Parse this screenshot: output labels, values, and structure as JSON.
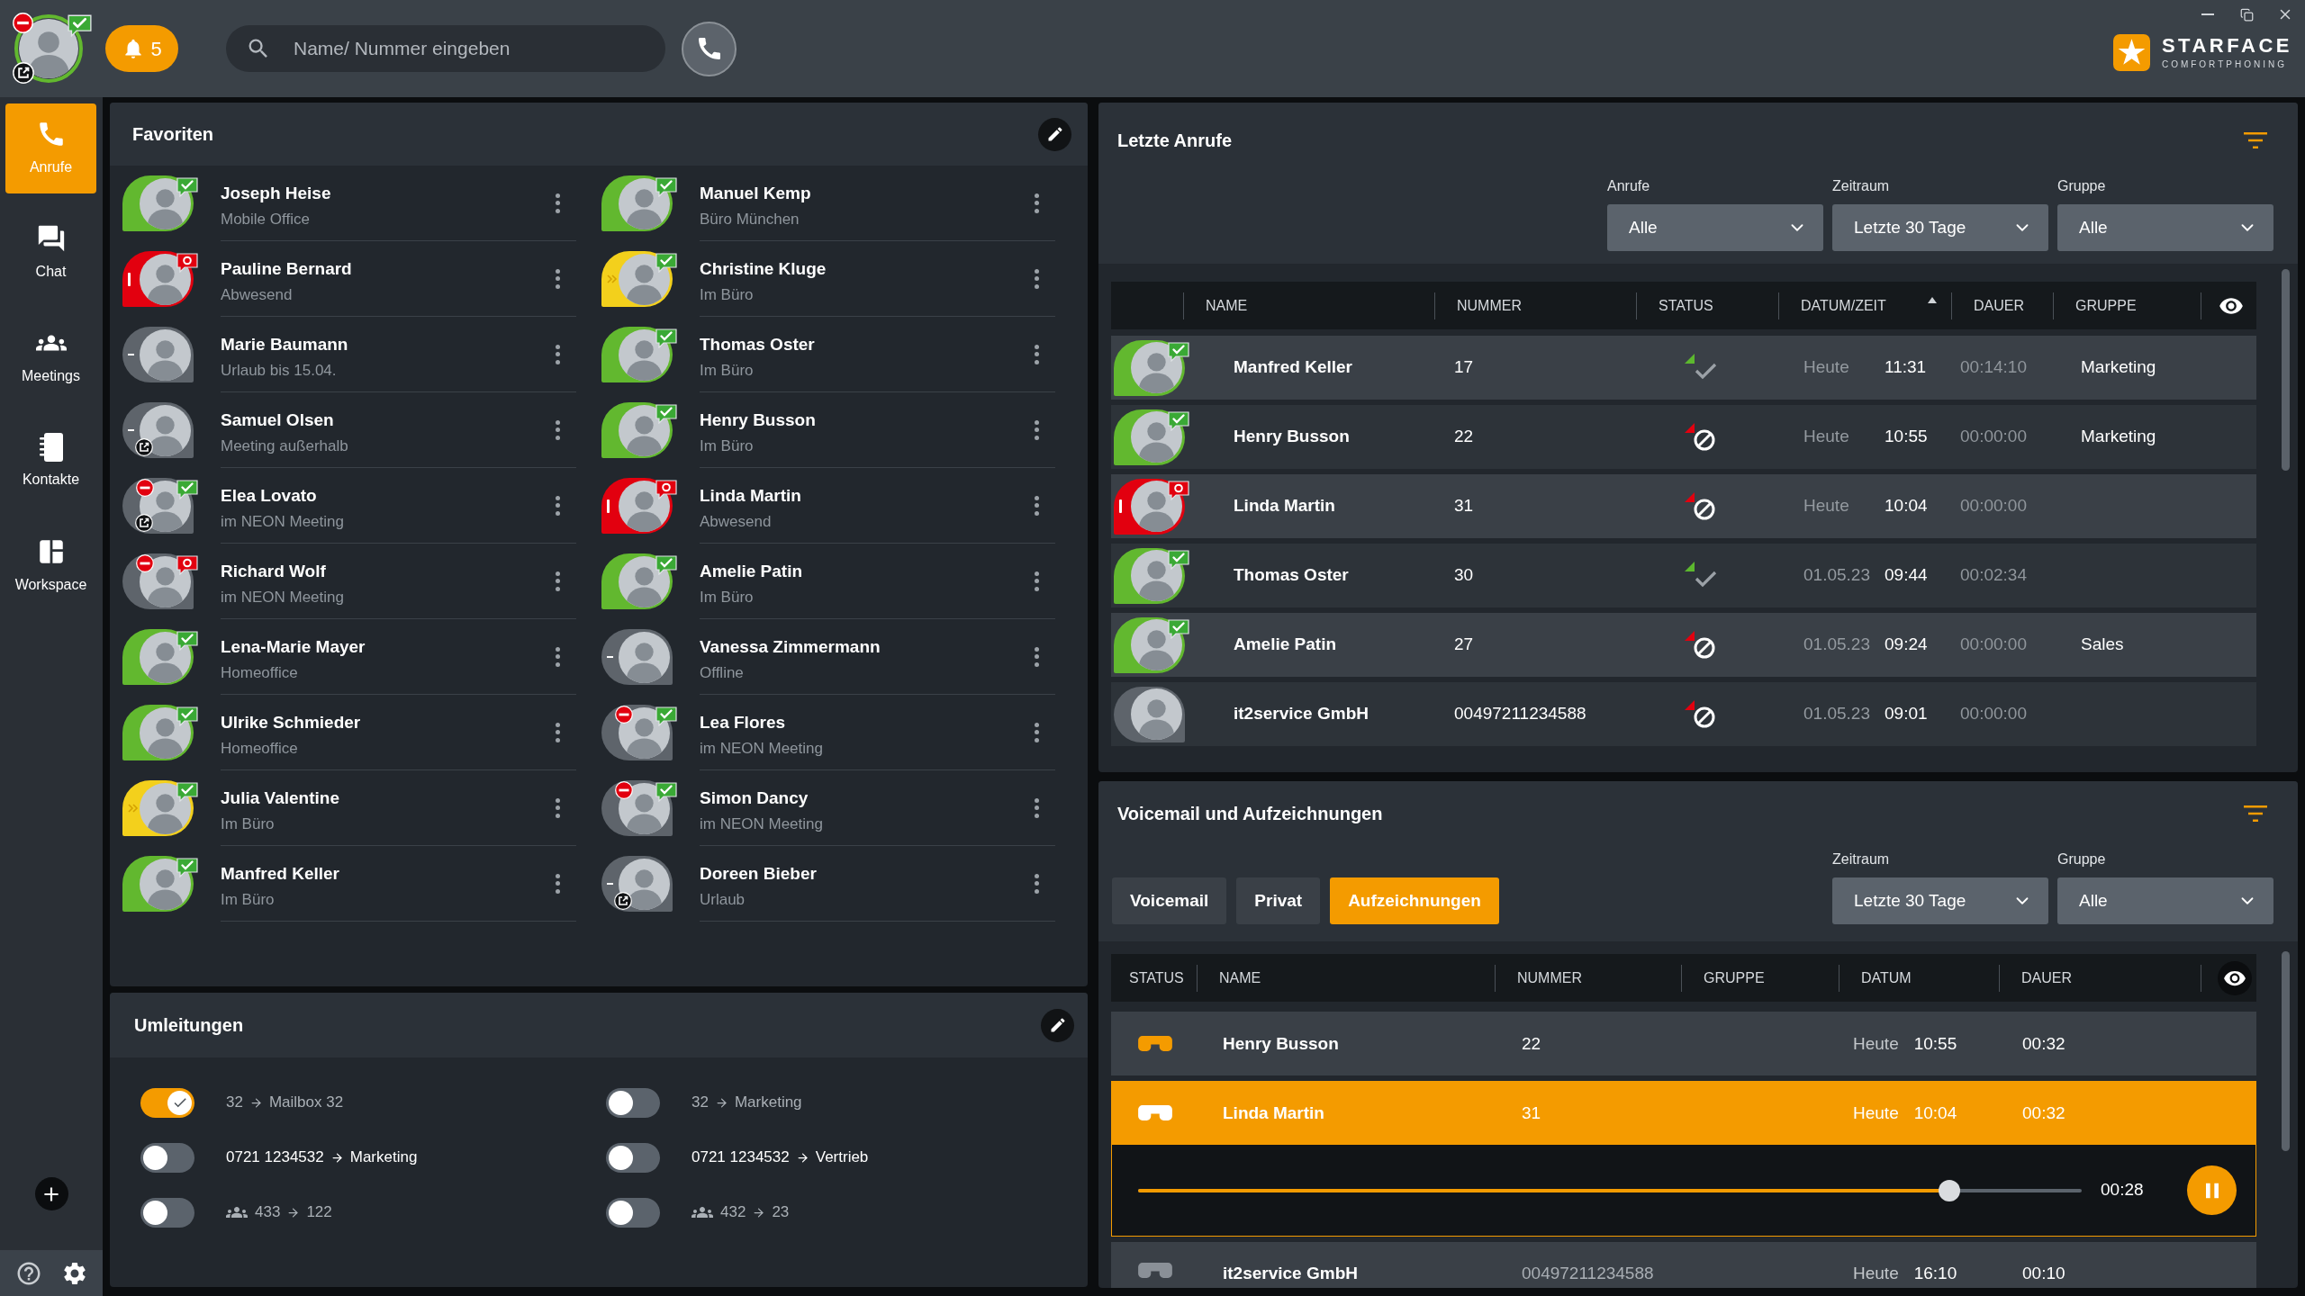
{
  "header": {
    "user": {
      "kind": "online",
      "chat_available": true,
      "chat_busy": false,
      "dnd": true,
      "redirect": true
    },
    "notifications": {
      "count": "5"
    },
    "search": {
      "placeholder": "Name/ Nummer eingeben"
    }
  },
  "logo": {
    "name": "STARFACE",
    "tagline": "COMFORTPHONING"
  },
  "sidebar": {
    "items": [
      {
        "label": "Anrufe",
        "selected": true
      },
      {
        "label": "Chat",
        "selected": false
      },
      {
        "label": "Meetings",
        "selected": false
      },
      {
        "label": "Kontakte",
        "selected": false
      },
      {
        "label": "Workspace",
        "selected": false
      }
    ]
  },
  "favorites": {
    "title": "Favoriten",
    "columns": [
      {
        "contacts": [
          {
            "name": "Joseph Heise",
            "status": "Mobile Office",
            "kind": "online",
            "chat_available": true,
            "chat_busy": false,
            "dnd": false,
            "redirect": false
          },
          {
            "name": "Pauline Bernard",
            "status": "Abwesend",
            "kind": "absent",
            "chat_available": false,
            "chat_busy": true,
            "dnd": false,
            "redirect": false
          },
          {
            "name": "Marie Baumann",
            "status": "Urlaub bis 15.04.",
            "kind": "offline",
            "chat_available": false,
            "chat_busy": false,
            "dnd": false,
            "redirect": false
          },
          {
            "name": "Samuel Olsen",
            "status": "Meeting außerhalb",
            "kind": "offline",
            "chat_available": false,
            "chat_busy": false,
            "dnd": false,
            "redirect": true
          },
          {
            "name": "Elea Lovato",
            "status": "im NEON Meeting",
            "kind": "unknown",
            "chat_available": true,
            "chat_busy": false,
            "dnd": true,
            "redirect": true
          },
          {
            "name": "Richard Wolf",
            "status": "im NEON Meeting",
            "kind": "unknown",
            "chat_available": false,
            "chat_busy": true,
            "dnd": true,
            "redirect": false
          },
          {
            "name": "Lena-Marie Mayer",
            "status": "Homeoffice",
            "kind": "online",
            "chat_available": true,
            "chat_busy": false,
            "dnd": false,
            "redirect": false
          },
          {
            "name": "Ulrike Schmieder",
            "status": "Homeoffice",
            "kind": "online",
            "chat_available": true,
            "chat_busy": false,
            "dnd": false,
            "redirect": false
          },
          {
            "name": "Julia Valentine",
            "status": "Im Büro",
            "kind": "forwarded",
            "chat_available": true,
            "chat_busy": false,
            "dnd": false,
            "redirect": false
          },
          {
            "name": "Manfred Keller",
            "status": "Im Büro",
            "kind": "online",
            "chat_available": true,
            "chat_busy": false,
            "dnd": false,
            "redirect": false
          }
        ]
      },
      {
        "contacts": [
          {
            "name": "Manuel Kemp",
            "status": "Büro München",
            "kind": "online",
            "chat_available": true,
            "chat_busy": false,
            "dnd": false,
            "redirect": false
          },
          {
            "name": "Christine Kluge",
            "status": "Im Büro",
            "kind": "forwarded",
            "chat_available": true,
            "chat_busy": false,
            "dnd": false,
            "redirect": false
          },
          {
            "name": "Thomas Oster",
            "status": "Im Büro",
            "kind": "online",
            "chat_available": true,
            "chat_busy": false,
            "dnd": false,
            "redirect": false
          },
          {
            "name": "Henry Busson",
            "status": "Im Büro",
            "kind": "online",
            "chat_available": true,
            "chat_busy": false,
            "dnd": false,
            "redirect": false
          },
          {
            "name": "Linda Martin",
            "status": "Abwesend",
            "kind": "absent",
            "chat_available": false,
            "chat_busy": true,
            "dnd": false,
            "redirect": false
          },
          {
            "name": "Amelie Patin",
            "status": "Im Büro",
            "kind": "online",
            "chat_available": true,
            "chat_busy": false,
            "dnd": false,
            "redirect": false
          },
          {
            "name": "Vanessa Zimmermann",
            "status": "Offline",
            "kind": "offline",
            "chat_available": false,
            "chat_busy": false,
            "dnd": false,
            "redirect": false
          },
          {
            "name": "Lea Flores",
            "status": "im NEON Meeting",
            "kind": "unknown",
            "chat_available": true,
            "chat_busy": false,
            "dnd": true,
            "redirect": false
          },
          {
            "name": "Simon Dancy",
            "status": "im NEON Meeting",
            "kind": "unknown",
            "chat_available": true,
            "chat_busy": false,
            "dnd": true,
            "redirect": false
          },
          {
            "name": "Doreen Bieber",
            "status": "Urlaub",
            "kind": "offline",
            "chat_available": false,
            "chat_busy": false,
            "dnd": false,
            "redirect": true
          }
        ]
      }
    ]
  },
  "forwarding": {
    "title": "Umleitungen",
    "rules": [
      {
        "kind": "internal",
        "on": true,
        "from": "32",
        "to": "Mailbox 32"
      },
      {
        "kind": "internal",
        "on": false,
        "from": "32",
        "to": "Marketing"
      },
      {
        "kind": "external",
        "on": false,
        "from": "0721 1234532",
        "to": "Marketing"
      },
      {
        "kind": "external",
        "on": false,
        "from": "0721 1234532",
        "to": "Vertrieb"
      },
      {
        "kind": "group",
        "on": false,
        "from": "433",
        "to": "122"
      },
      {
        "kind": "group",
        "on": false,
        "from": "432",
        "to": "23"
      }
    ]
  },
  "recent_calls": {
    "title": "Letzte Anrufe",
    "filters": [
      {
        "label": "Anrufe",
        "value": "Alle"
      },
      {
        "label": "Zeitraum",
        "value": "Letzte 30 Tage"
      },
      {
        "label": "Gruppe",
        "value": "Alle"
      }
    ],
    "columns": [
      {
        "label": "NAME",
        "sorted": false
      },
      {
        "label": "NUMMER",
        "sorted": false
      },
      {
        "label": "STATUS",
        "sorted": false
      },
      {
        "label": "DATUM/ZEIT",
        "sorted": true
      },
      {
        "label": "DAUER",
        "sorted": false
      },
      {
        "label": "GRUPPE",
        "sorted": false
      }
    ],
    "rows": [
      {
        "avatar": {
          "kind": "online",
          "chat_available": true,
          "chat_busy": false,
          "dnd": false,
          "redirect": false
        },
        "name": "Manfred Keller",
        "number": "17",
        "missed": false,
        "date": "Heute",
        "time": "11:31",
        "duration": "00:14:10",
        "group": "Marketing"
      },
      {
        "avatar": {
          "kind": "online",
          "chat_available": true,
          "chat_busy": false,
          "dnd": false,
          "redirect": false
        },
        "name": "Henry Busson",
        "number": "22",
        "missed": true,
        "date": "Heute",
        "time": "10:55",
        "duration": "00:00:00",
        "group": "Marketing"
      },
      {
        "avatar": {
          "kind": "absent",
          "chat_available": false,
          "chat_busy": true,
          "dnd": false,
          "redirect": false
        },
        "name": "Linda Martin",
        "number": "31",
        "missed": true,
        "date": "Heute",
        "time": "10:04",
        "duration": "00:00:00"
      },
      {
        "avatar": {
          "kind": "online",
          "chat_available": true,
          "chat_busy": false,
          "dnd": false,
          "redirect": false
        },
        "name": "Thomas Oster",
        "number": "30",
        "missed": false,
        "date": "01.05.23",
        "time": "09:44",
        "duration": "00:02:34"
      },
      {
        "avatar": {
          "kind": "online",
          "chat_available": true,
          "chat_busy": false,
          "dnd": false,
          "redirect": false
        },
        "name": "Amelie Patin",
        "number": "27",
        "missed": true,
        "date": "01.05.23",
        "time": "09:24",
        "duration": "00:00:00",
        "group": "Sales"
      },
      {
        "avatar": {
          "kind": "unknown",
          "chat_available": false,
          "chat_busy": false,
          "dnd": false,
          "redirect": false
        },
        "name": "it2service GmbH",
        "number": "00497211234588",
        "missed": true,
        "date": "01.05.23",
        "time": "09:01",
        "duration": "00:00:00"
      }
    ]
  },
  "voicemail": {
    "title": "Voicemail und Aufzeichnungen",
    "tabs": [
      {
        "label": "Voicemail",
        "selected": false
      },
      {
        "label": "Privat",
        "selected": false
      },
      {
        "label": "Aufzeichnungen",
        "selected": true
      }
    ],
    "filters": [
      {
        "label": "Zeitraum",
        "value": "Letzte 30 Tage"
      },
      {
        "label": "Gruppe",
        "value": "Alle"
      }
    ],
    "columns": [
      {
        "label": "STATUS"
      },
      {
        "label": "NAME"
      },
      {
        "label": "NUMMER"
      },
      {
        "label": "GRUPPE"
      },
      {
        "label": "DATUM"
      },
      {
        "label": "DAUER"
      }
    ],
    "rows": [
      {
        "name": "Henry Busson",
        "number": "22",
        "date": "Heute",
        "time": "10:55",
        "duration": "00:32",
        "unheard": true,
        "selected": false
      },
      {
        "name": "Linda Martin",
        "number": "31",
        "date": "Heute",
        "time": "10:04",
        "duration": "00:32",
        "unheard": true,
        "selected": true,
        "player": {
          "level": 0.86,
          "time": "00:28",
          "playing": true
        }
      },
      {
        "name": "it2service GmbH",
        "number": "00497211234588",
        "date": "Heute",
        "time": "16:10",
        "duration": "00:10",
        "unheard": false,
        "selected": false
      }
    ]
  }
}
